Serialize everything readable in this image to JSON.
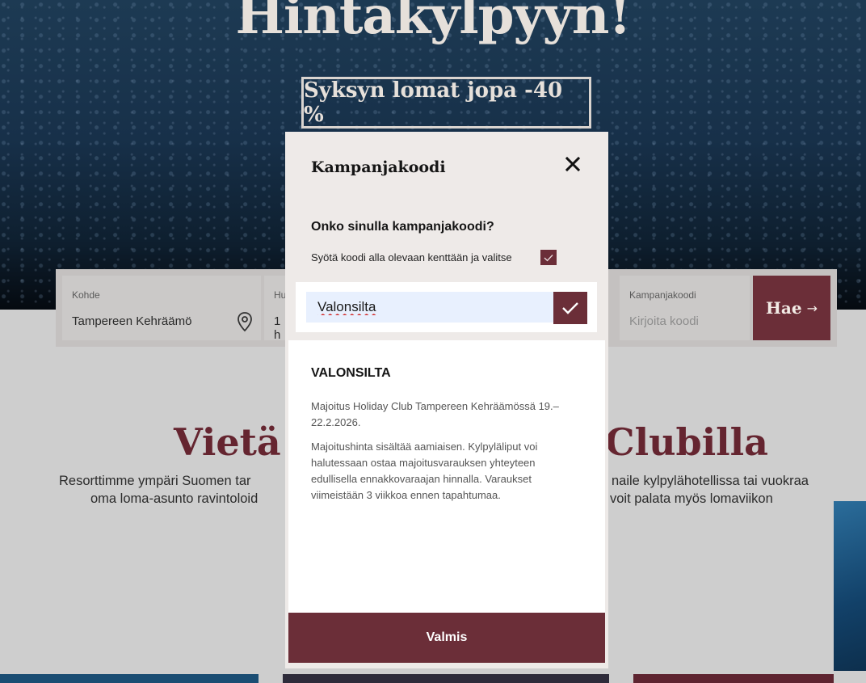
{
  "hero": {
    "title": "Hintakylpyyn!",
    "badge": "Syksyn lomat jopa -40 %"
  },
  "search": {
    "destination_label": "Kohde",
    "destination_value": "Tampereen Kehräämö",
    "guests_label_partial": "Hu",
    "guests_value_partial": "1 h",
    "campaign_label": "Kampanjakoodi",
    "campaign_placeholder": "Kirjoita koodi",
    "search_button": "Hae",
    "search_arrow": "→"
  },
  "section": {
    "title_left": "Vietä pa",
    "title_right": "Clubilla",
    "line1_left": "Resorttimme ympäri Suomen tar",
    "line1_right": "naile kylpylähotellissa tai vuokraa",
    "line2_left": "oma loma-asunto ravintoloid",
    "line2_right": "voit palata myös lomaviikon"
  },
  "modal": {
    "title": "Kampanjakoodi",
    "question": "Onko sinulla kampanjakoodi?",
    "instruction": "Syötä koodi alla olevaan kenttään ja valitse",
    "code_value": "Valonsilta",
    "result_title": "VALONSILTA",
    "result_p1": "Majoitus Holiday Club Tampereen Kehräämössä 19.–22.2.2026.",
    "result_p2": "Majoitushinta sisältää aamiaisen. Kylpyläliput voi halutessaan ostaa majoitusvarauksen yhteyteen edullisella ennakkovaraajan hinnalla. Varaukset viimeistään 3 viikkoa ennen tapahtumaa.",
    "done_button": "Valmis"
  },
  "colors": {
    "brand": "#6b2e38",
    "heading": "#652530"
  }
}
